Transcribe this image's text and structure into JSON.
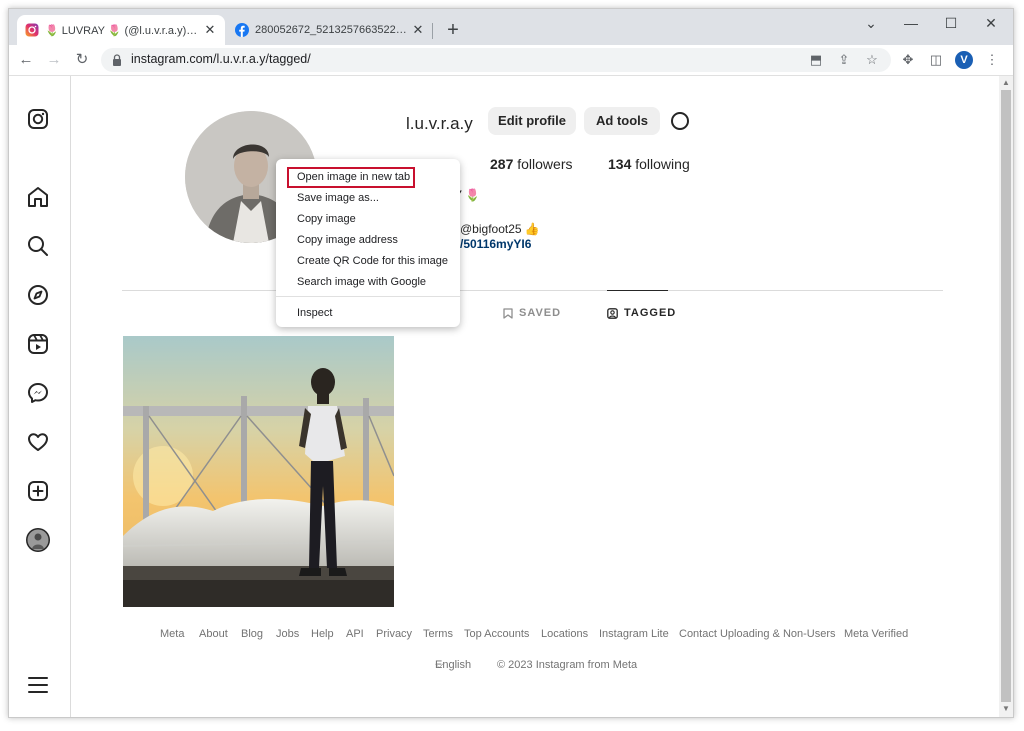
{
  "browser": {
    "tabs": [
      {
        "title": "🌷 LUVRAY 🌷 (@l.u.v.r.a.y) • Inst",
        "favicon": "instagram-icon"
      },
      {
        "title": "280052672_521325766352256_3",
        "favicon": "facebook-icon"
      }
    ],
    "url": "instagram.com/l.u.v.r.a.y/tagged/",
    "profile_initial": "V"
  },
  "profile": {
    "username": "l.u.v.r.a.y",
    "edit_profile_label": "Edit profile",
    "ad_tools_label": "Ad tools",
    "followers_count": "287",
    "followers_label": "followers",
    "following_count": "134",
    "following_label": "following",
    "name_fragment": "Y 🌷",
    "bio_mention": "@bigfoot25 👍",
    "bio_link_fragment": "/50116myYI6"
  },
  "profile_tabs": {
    "saved": "SAVED",
    "tagged": "TAGGED"
  },
  "context_menu": {
    "items": [
      "Open image in new tab",
      "Save image as...",
      "Copy image",
      "Copy image address",
      "Create QR Code for this image",
      "Search image with Google",
      "Inspect"
    ],
    "highlighted_index": 0
  },
  "footer": {
    "links": [
      "Meta",
      "About",
      "Blog",
      "Jobs",
      "Help",
      "API",
      "Privacy",
      "Terms",
      "Top Accounts",
      "Locations",
      "Instagram Lite",
      "Contact Uploading & Non-Users",
      "Meta Verified"
    ],
    "language": "English",
    "copyright": "© 2023 Instagram from Meta"
  },
  "colors": {
    "highlight_box": "#c8102e",
    "link": "#00376b",
    "tabbar": "#dee1e6"
  }
}
